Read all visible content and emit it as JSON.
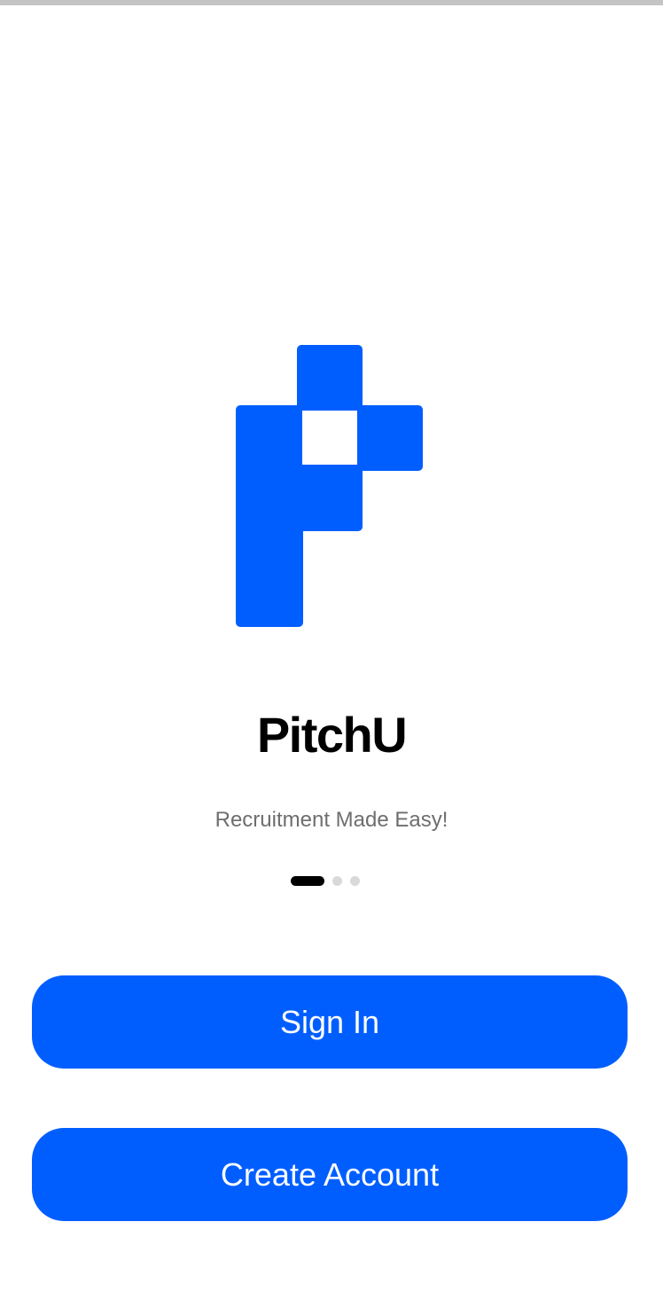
{
  "app": {
    "title": "PitchU",
    "tagline": "Recruitment Made Easy!",
    "logo_icon": "pitchu-p-logo-icon"
  },
  "pager": {
    "page_count": 3,
    "active_index": 0
  },
  "buttons": {
    "sign_in": "Sign In",
    "create_account": "Create Account"
  },
  "colors": {
    "brand_blue": "#005eff",
    "title": "#000000",
    "tagline": "#6e6e6e",
    "pager_active": "#000000",
    "pager_inactive": "#d9d9d9"
  }
}
